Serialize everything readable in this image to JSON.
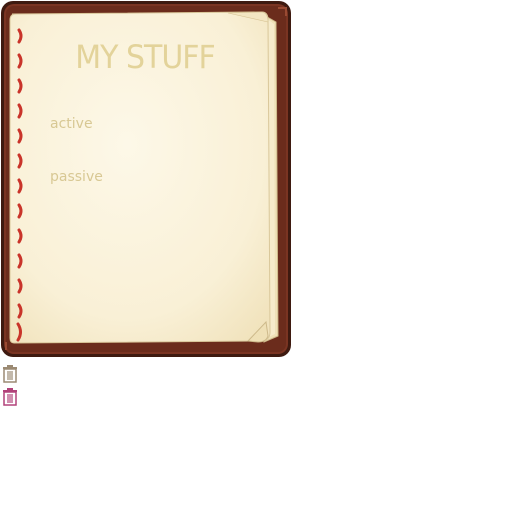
{
  "journal": {
    "title": "MY STUFF",
    "sections": {
      "active_label": "active",
      "passive_label": "passive"
    }
  },
  "icons": {
    "trash_normal": "trash-icon",
    "trash_hover": "trash-icon-highlighted"
  },
  "colors": {
    "cover": "#6b2c1c",
    "cover_edge": "#3e1a10",
    "paper": "#fbf3dc",
    "stitching": "#c9342a",
    "title_text": "#e3d39a",
    "label_text": "#d8c894",
    "trash_normal": "#9b8a73",
    "trash_hover": "#b2427a"
  }
}
